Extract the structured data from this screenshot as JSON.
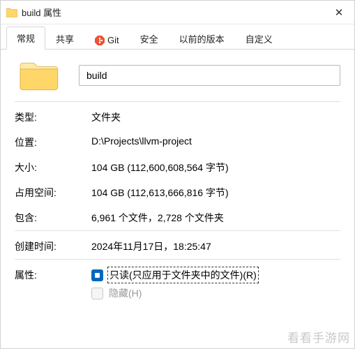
{
  "window": {
    "title": "build 属性",
    "close_glyph": "✕"
  },
  "tabs": {
    "general": "常规",
    "sharing": "共享",
    "git": "Git",
    "security": "安全",
    "previous_versions": "以前的版本",
    "customize": "自定义"
  },
  "folder": {
    "name": "build"
  },
  "props": {
    "type_label": "类型:",
    "type_value": "文件夹",
    "location_label": "位置:",
    "location_value": "D:\\Projects\\llvm-project",
    "size_label": "大小:",
    "size_value": "104 GB (112,600,608,564 字节)",
    "sizeondisk_label": "占用空间:",
    "sizeondisk_value": "104 GB (112,613,666,816 字节)",
    "contains_label": "包含:",
    "contains_value": "6,961 个文件，2,728 个文件夹",
    "created_label": "创建时间:",
    "created_value": "2024年11月17日，18:25:47"
  },
  "attributes": {
    "label": "属性:",
    "readonly": "只读(只应用于文件夹中的文件)(R)",
    "hidden": "隐藏(H)"
  },
  "watermark": "看看手游网"
}
